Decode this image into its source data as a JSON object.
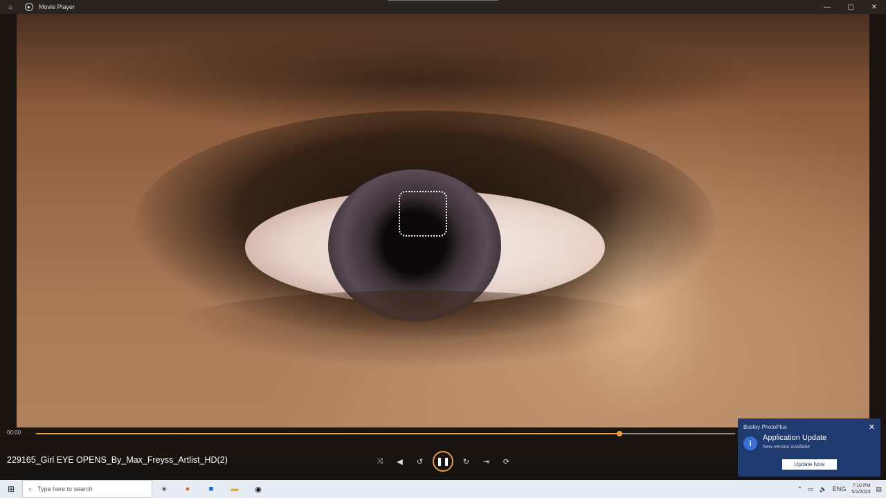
{
  "window": {
    "app_title": "Movie Player"
  },
  "player": {
    "elapsed": "00:00",
    "progress_fraction": 0.835,
    "accent": "#e89a45",
    "media_title": "229165_Girl EYE OPENS_By_Max_Freyss_Artlist_HD(2)"
  },
  "notification": {
    "app_name": "Bosley PhotoPlus",
    "heading": "Application Update",
    "message": "New version available",
    "button": "Update Now",
    "color": "#1f3a6e"
  },
  "taskbar": {
    "search_placeholder": "Type here to search",
    "lang": "ENG",
    "time": "7:10 PM",
    "date": "5/1/2023"
  }
}
